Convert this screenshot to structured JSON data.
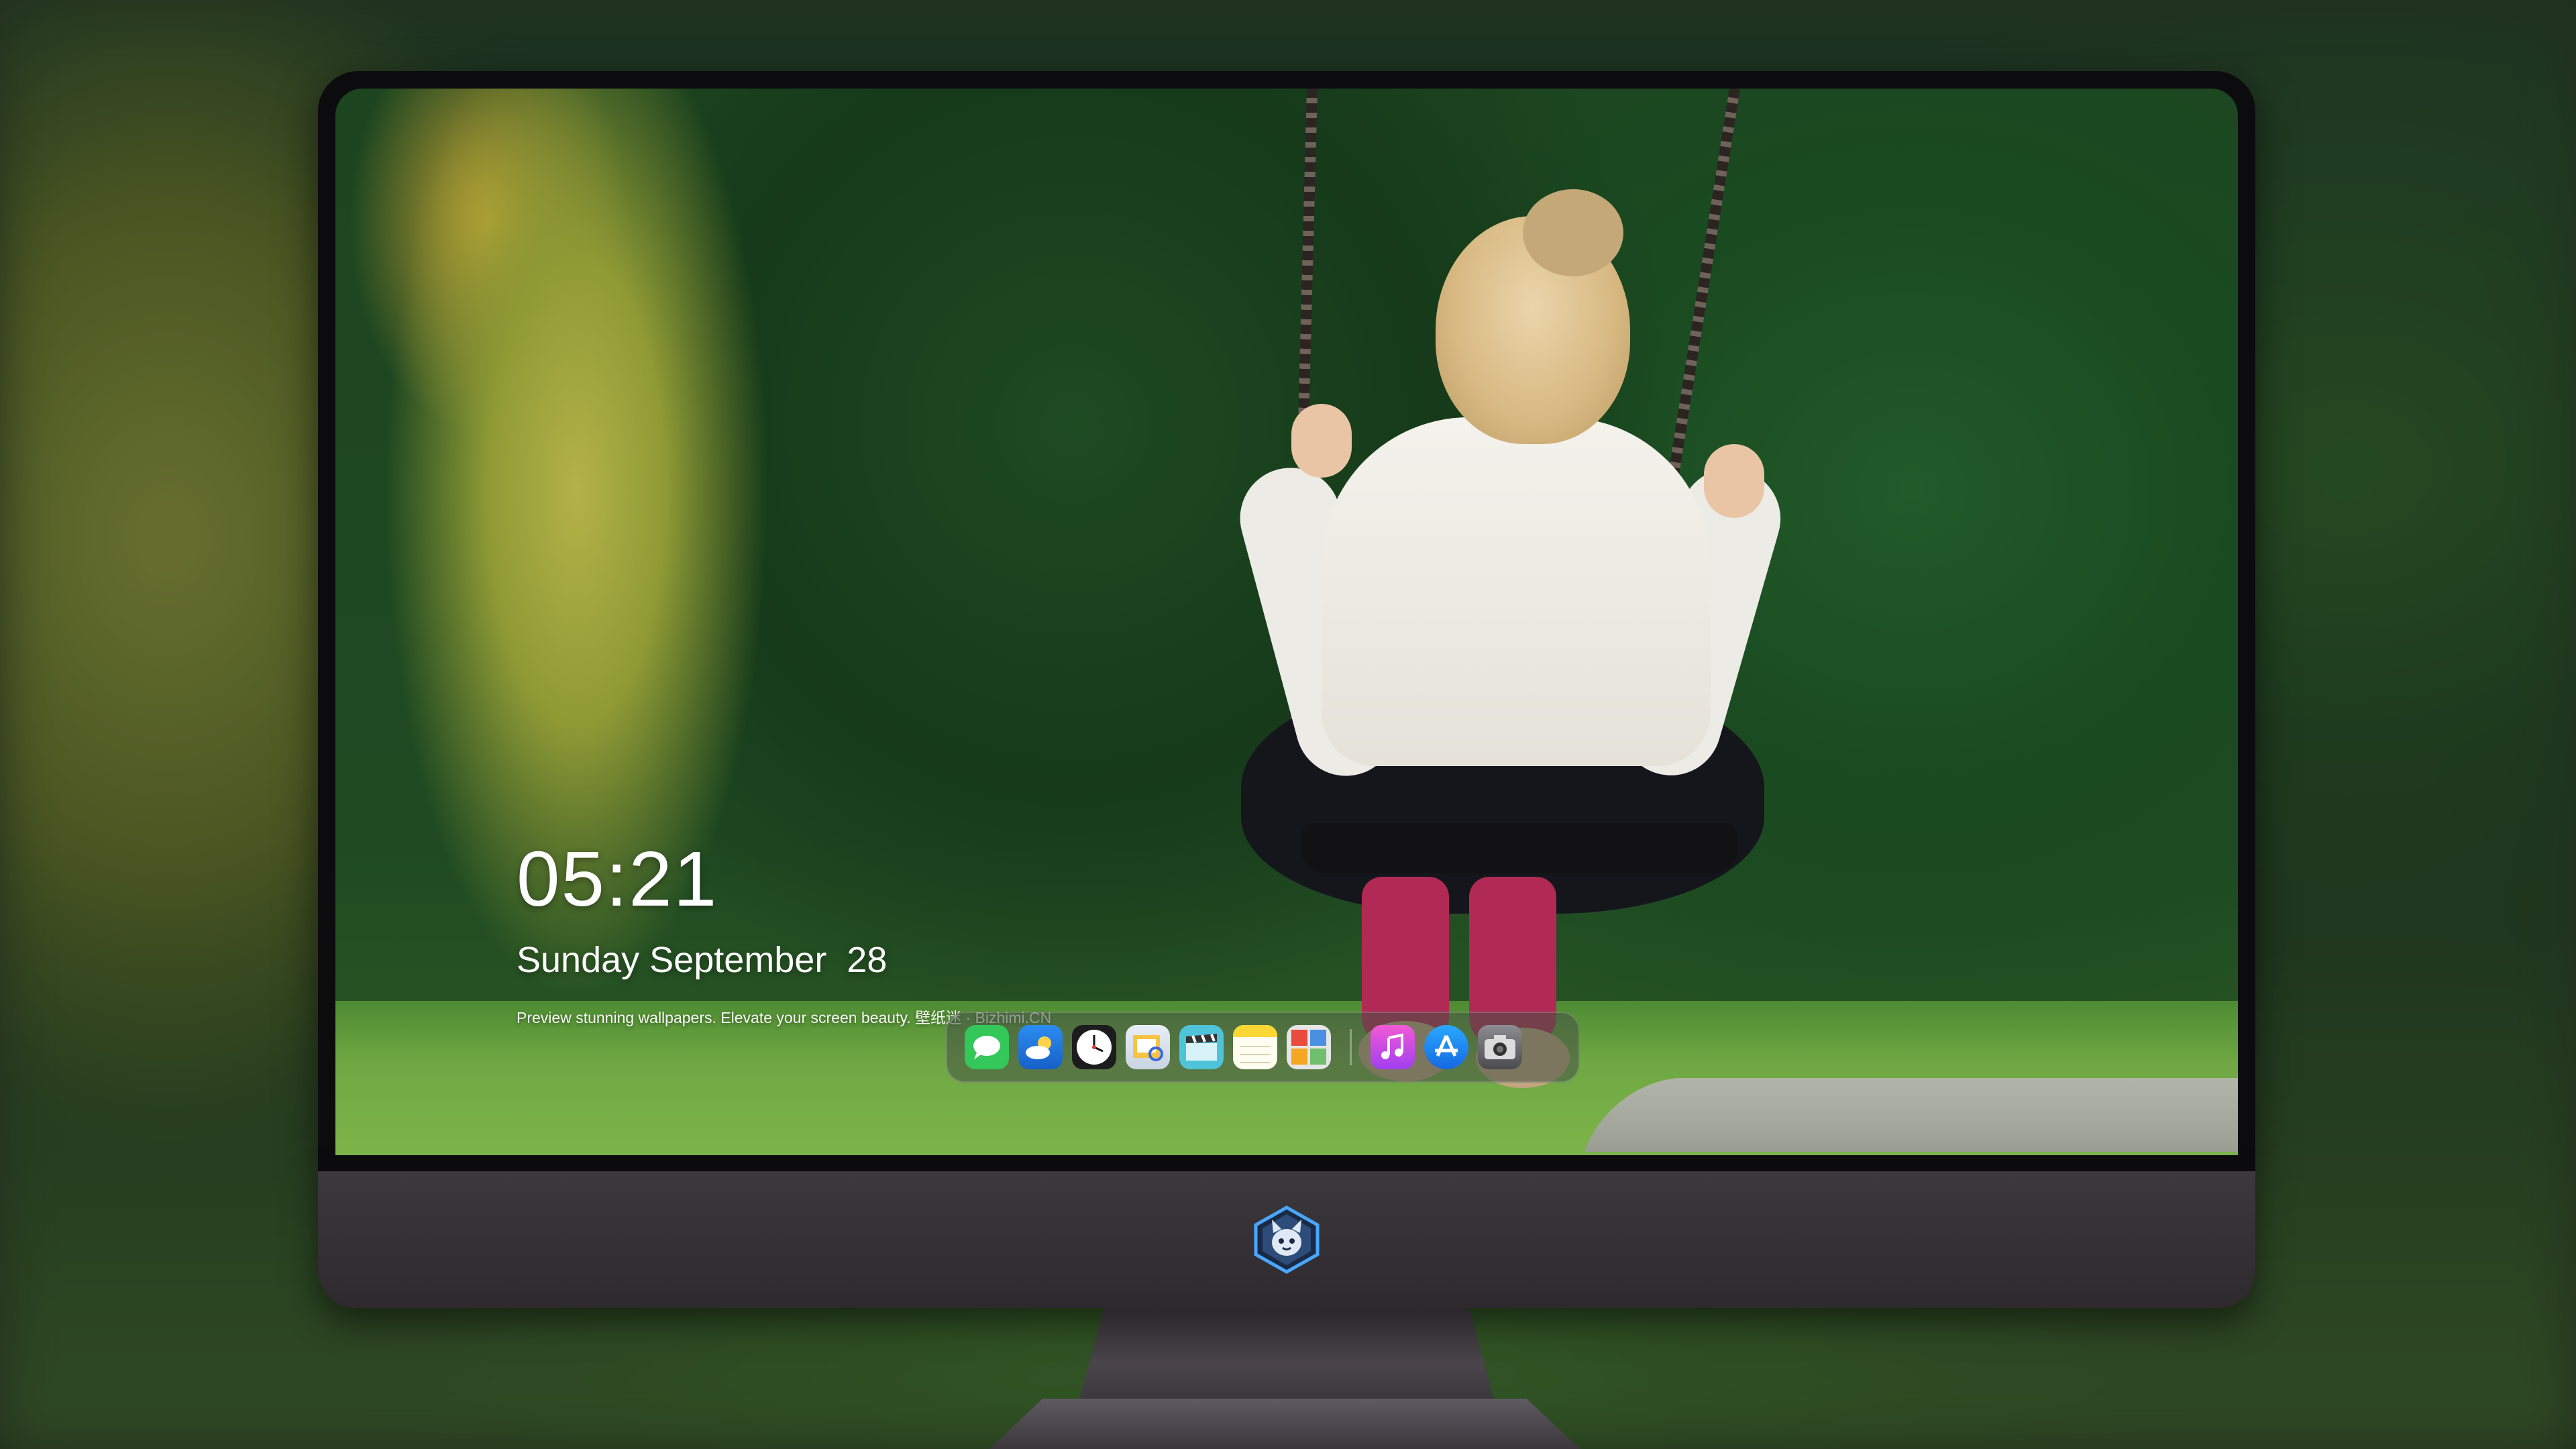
{
  "lockscreen": {
    "time": "05:21",
    "date": "Sunday September  28",
    "tagline": "Preview stunning wallpapers. Elevate your screen beauty. 壁纸迷 · Bizhimi.CN"
  },
  "dock": {
    "apps": [
      {
        "name": "messages-icon",
        "color": "#34c759"
      },
      {
        "name": "weather-icon",
        "color": "#1e88e5"
      },
      {
        "name": "clock-icon",
        "color": "#1c1c1e"
      },
      {
        "name": "preview-icon",
        "color": "#f2c94c"
      },
      {
        "name": "claquette-icon",
        "color": "#4fc3d9"
      },
      {
        "name": "notes-icon",
        "color": "#fdd835"
      },
      {
        "name": "photo-booth-icon",
        "color": "#6fbf6f"
      },
      {
        "name": "itunes-icon",
        "color": "#d64ad8"
      },
      {
        "name": "app-store-icon",
        "color": "#1e8cf0"
      },
      {
        "name": "camera-icon",
        "color": "#5b5b5f"
      }
    ]
  },
  "branding": {
    "logo": "bizhimi-mascot-logo",
    "accent": "#4aa6ff"
  }
}
